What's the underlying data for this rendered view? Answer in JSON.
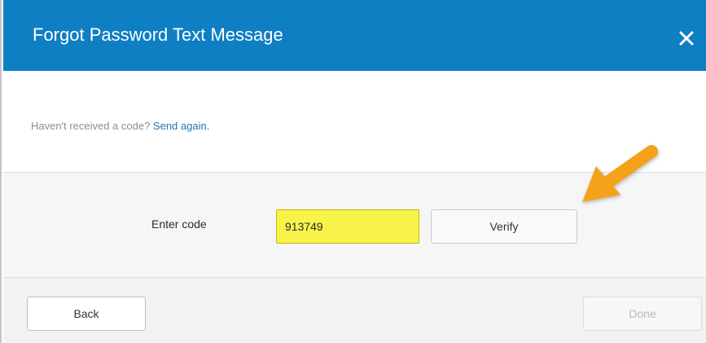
{
  "dialog": {
    "title": "Forgot Password Text Message",
    "close_icon": "close-icon"
  },
  "resend": {
    "prompt": "Haven't received a code?",
    "link": "Send again."
  },
  "code": {
    "label": "Enter code",
    "value": "913749",
    "verify_label": "Verify"
  },
  "footer": {
    "back_label": "Back",
    "done_label": "Done",
    "done_enabled": false
  },
  "colors": {
    "header": "#0f7fc4",
    "input_highlight": "#f8f34b",
    "arrow": "#f4a11a",
    "link": "#1f77b4"
  }
}
